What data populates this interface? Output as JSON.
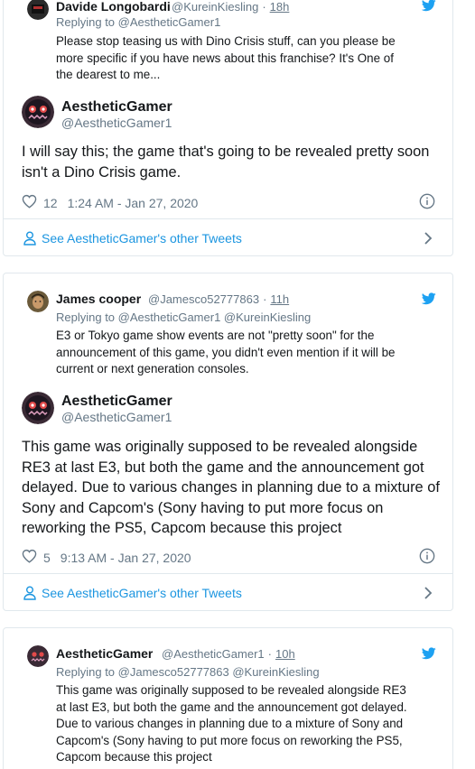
{
  "colors": {
    "link": "#1b95e0",
    "muted": "#657786",
    "border": "#e1e8ed",
    "twitter_blue": "#1da1f2"
  },
  "cards": [
    {
      "quoted": {
        "name": "Davide Longobardi",
        "handle": "@KureinKiesling",
        "sep": "·",
        "time": "18h",
        "replying_prefix": "Replying to",
        "replying_to": "@AestheticGamer1",
        "text_lines": [
          "Please stop teasing us with Dino Crisis stuff, can you please be",
          "more specific if you have news about this franchise? It's One of",
          "the dearest to me..."
        ]
      },
      "main": {
        "name": "AestheticGamer",
        "handle": "@AestheticGamer1",
        "text_lines": [
          "I will say this; the game that's going to be revealed pretty soon",
          "isn't a Dino Crisis game."
        ],
        "likes": "12",
        "timestamp": "1:24 AM - Jan 27, 2020"
      },
      "footer": "See AestheticGamer's other Tweets"
    },
    {
      "quoted": {
        "name": "James cooper",
        "handle": "@Jamesco52777863",
        "sep": "·",
        "time": "11h",
        "replying_prefix": "Replying to",
        "replying_to": "@AestheticGamer1 @KureinKiesling",
        "text_lines": [
          "E3 or Tokyo game show events are not \"pretty soon\" for the",
          "announcement of this game, you didn't even mention if it will be",
          "current or next generation consoles."
        ]
      },
      "main": {
        "name": "AestheticGamer",
        "handle": "@AestheticGamer1",
        "text_lines": [
          "This game was originally supposed to be revealed alongside",
          "RE3 at last E3, but both the game and the announcement got",
          "delayed. Due to various changes in planning due to a mixture of",
          "Sony and Capcom's (Sony having to put more focus on",
          "reworking the PS5, Capcom because this project"
        ],
        "likes": "5",
        "timestamp": "9:13 AM - Jan 27, 2020"
      },
      "footer": "See AestheticGamer's other Tweets"
    },
    {
      "quoted": {
        "name": "AestheticGamer",
        "handle": "@AestheticGamer1",
        "sep": "·",
        "time": "10h",
        "replying_prefix": "Replying to",
        "replying_to": "@Jamesco52777863 @KureinKiesling",
        "text_lines": [
          "This game was originally supposed to be revealed alongside RE3",
          "at last E3, but both the game and the announcement got delayed.",
          "Due to various changes in planning due to a mixture of Sony and",
          "Capcom's (Sony having to put more focus on reworking the PS5,",
          "Capcom because this project"
        ]
      }
    }
  ]
}
